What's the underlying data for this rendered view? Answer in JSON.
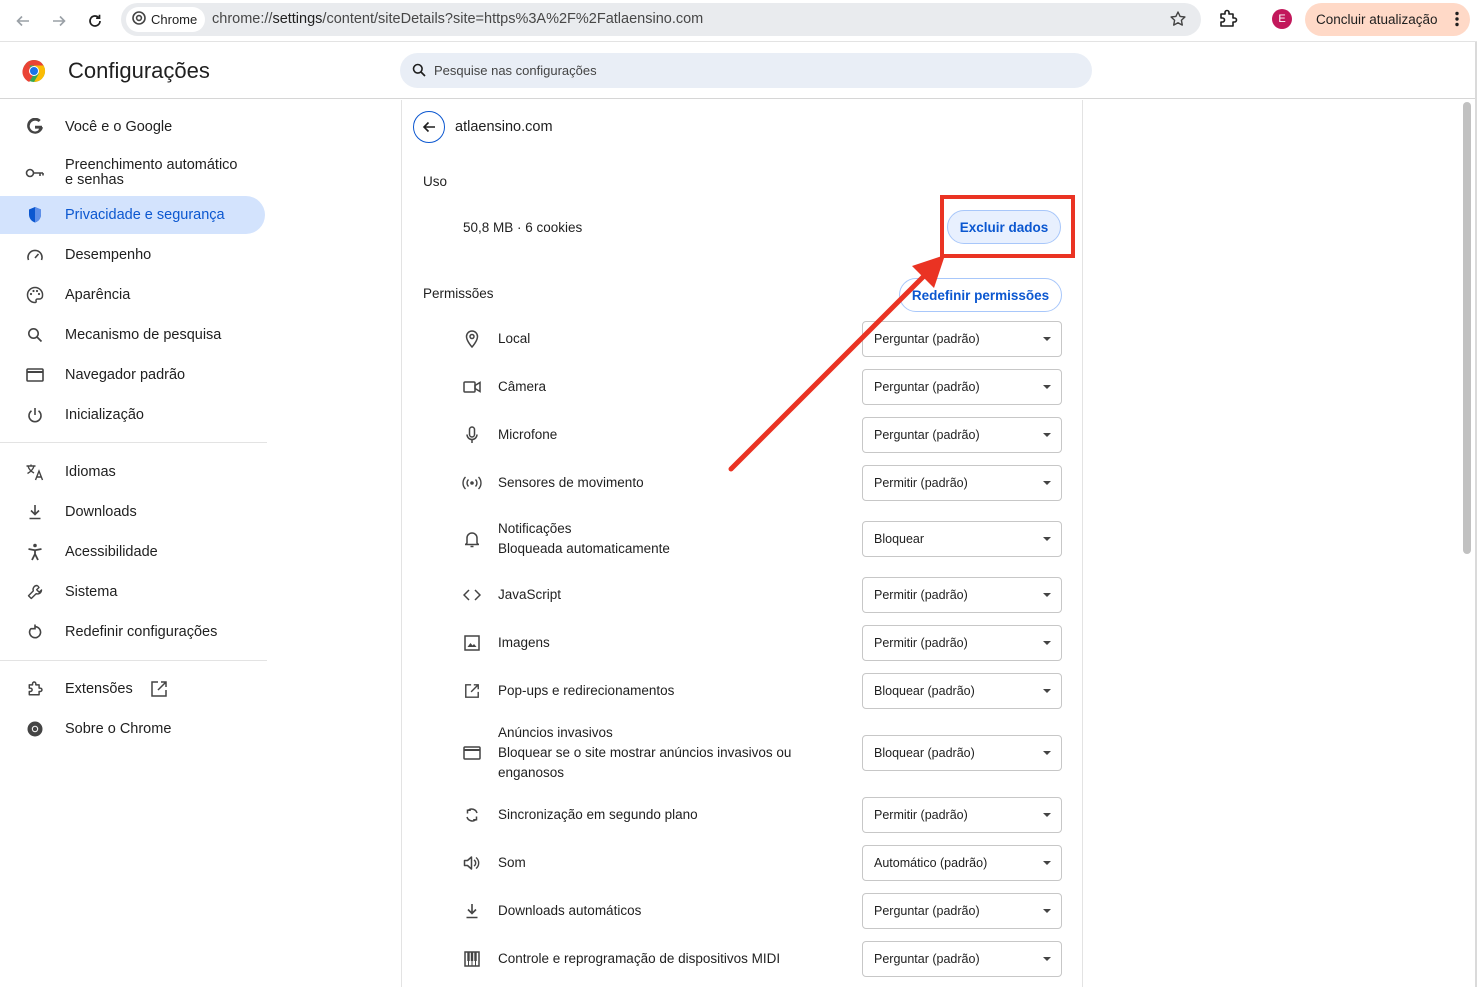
{
  "browser": {
    "chip_label": "Chrome",
    "url_prefix": "chrome://",
    "url_host": "settings",
    "url_rest": "/content/siteDetails?site=https%3A%2F%2Fatlaensino.com",
    "avatar_letter": "E",
    "update_label": "Concluir atualização"
  },
  "header": {
    "title": "Configurações",
    "search_placeholder": "Pesquise nas configurações"
  },
  "sidebar": {
    "items": [
      {
        "label": "Você e o Google",
        "icon": "google-g-icon"
      },
      {
        "label": "Preenchimento automático e senhas",
        "label_line1": "Preenchimento automático",
        "label_line2": "e senhas",
        "icon": "key-icon"
      },
      {
        "label": "Privacidade e segurança",
        "icon": "shield-icon",
        "active": true
      },
      {
        "label": "Desempenho",
        "icon": "speedometer-icon"
      },
      {
        "label": "Aparência",
        "icon": "palette-icon"
      },
      {
        "label": "Mecanismo de pesquisa",
        "icon": "search-icon"
      },
      {
        "label": "Navegador padrão",
        "icon": "browser-window-icon"
      },
      {
        "label": "Inicialização",
        "icon": "power-icon"
      },
      {
        "label": "Idiomas",
        "icon": "translate-icon"
      },
      {
        "label": "Downloads",
        "icon": "download-icon"
      },
      {
        "label": "Acessibilidade",
        "icon": "accessibility-icon"
      },
      {
        "label": "Sistema",
        "icon": "wrench-icon"
      },
      {
        "label": "Redefinir configurações",
        "icon": "reset-icon"
      },
      {
        "label": "Extensões",
        "icon": "puzzle-icon"
      },
      {
        "label": "Sobre o Chrome",
        "icon": "chrome-icon"
      }
    ]
  },
  "site": {
    "name": "atlaensino.com",
    "usage_heading": "Uso",
    "usage_text": "50,8 MB · 6 cookies",
    "delete_data_label": "Excluir dados",
    "permissions_heading": "Permissões",
    "reset_permissions_label": "Redefinir permissões"
  },
  "permissions": [
    {
      "label": "Local",
      "value": "Perguntar (padrão)",
      "icon": "location-pin-icon"
    },
    {
      "label": "Câmera",
      "value": "Perguntar (padrão)",
      "icon": "camera-icon"
    },
    {
      "label": "Microfone",
      "value": "Perguntar (padrão)",
      "icon": "microphone-icon"
    },
    {
      "label": "Sensores de movimento",
      "value": "Permitir (padrão)",
      "icon": "sensors-icon"
    },
    {
      "label": "Notificações",
      "sublabel": "Bloqueada automaticamente",
      "value": "Bloquear",
      "icon": "bell-icon"
    },
    {
      "label": "JavaScript",
      "value": "Permitir (padrão)",
      "icon": "code-icon"
    },
    {
      "label": "Imagens",
      "value": "Permitir (padrão)",
      "icon": "image-icon"
    },
    {
      "label": "Pop-ups e redirecionamentos",
      "value": "Bloquear (padrão)",
      "icon": "open-in-new-icon"
    },
    {
      "label": "Anúncios invasivos",
      "sublabel": "Bloquear se o site mostrar anúncios invasivos ou enganosos",
      "value": "Bloquear (padrão)",
      "icon": "ads-window-icon"
    },
    {
      "label": "Sincronização em segundo plano",
      "value": "Permitir (padrão)",
      "icon": "sync-icon"
    },
    {
      "label": "Som",
      "value": "Automático (padrão)",
      "icon": "volume-icon"
    },
    {
      "label": "Downloads automáticos",
      "value": "Perguntar (padrão)",
      "icon": "download-icon"
    },
    {
      "label": "Controle e reprogramação de dispositivos MIDI",
      "value": "Perguntar (padrão)",
      "icon": "piano-icon"
    }
  ],
  "colors": {
    "accent": "#0b57d0",
    "active_bg": "#d3e3fd",
    "annotation": "#ea3323",
    "update_bg": "#ffd9c7"
  }
}
